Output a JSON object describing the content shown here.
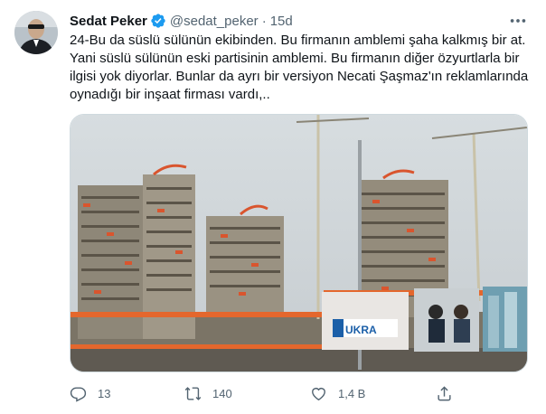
{
  "author": {
    "name": "Sedat Peker",
    "handle": "@sedat_peker",
    "separator": "·",
    "age": "15d"
  },
  "tweet": {
    "lines": [
      "24-Bu da süslü sülünün ekibinden. Bu firmanın amblemi şaha kalkmış bir at.",
      "Yani süslü sülünün eski partisinin amblemi. Bu firmanın diğer özyurtlarla bir",
      "ilgisi yok diyorlar. Bunlar da ayrı bir versiyon Necati Şaşmaz'ın reklamlarında",
      "oynadığı bir inşaat firması vardı,.."
    ]
  },
  "media": {
    "billboard_text": "UKRA"
  },
  "actions": {
    "replies": "13",
    "retweets": "140",
    "likes": "1,4 B"
  },
  "colors": {
    "accent": "#1d9bf0",
    "text": "#0f1419",
    "muted": "#536471"
  },
  "icons": [
    "verified-badge-icon",
    "more-options-icon",
    "reply-icon",
    "retweet-icon",
    "like-icon",
    "share-icon"
  ]
}
